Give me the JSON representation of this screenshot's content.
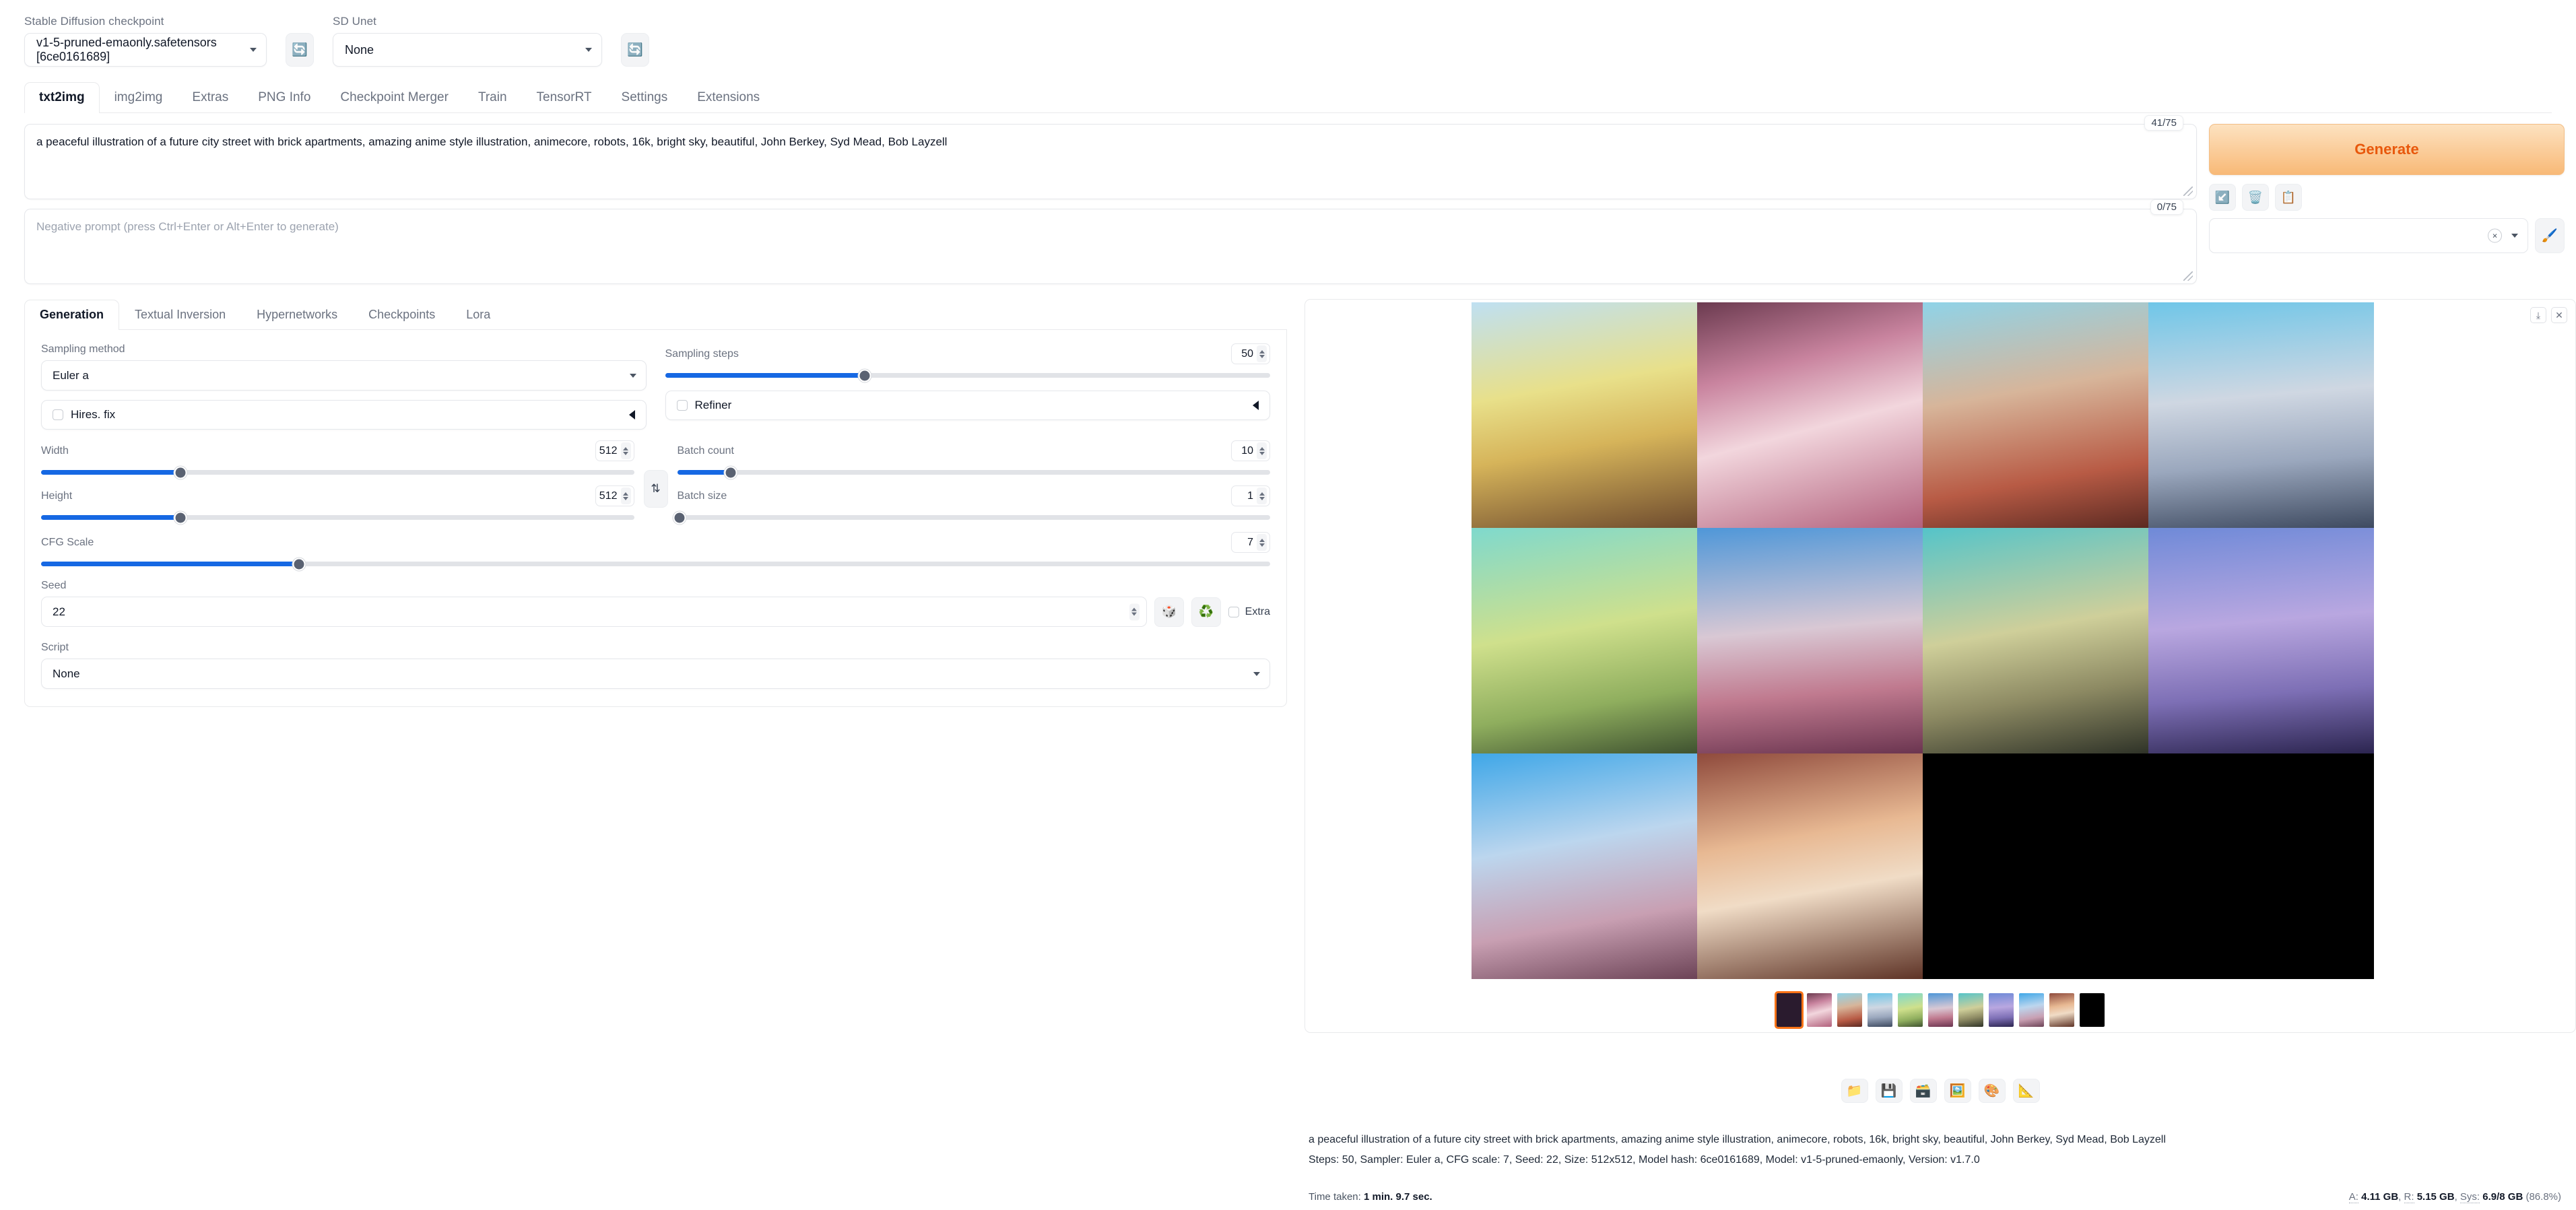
{
  "topbar": {
    "checkpoint_label": "Stable Diffusion checkpoint",
    "checkpoint_value": "v1-5-pruned-emaonly.safetensors [6ce0161689]",
    "unet_label": "SD Unet",
    "unet_value": "None",
    "refresh_icon": "refresh-icon"
  },
  "main_tabs": [
    {
      "label": "txt2img",
      "active": true
    },
    {
      "label": "img2img",
      "active": false
    },
    {
      "label": "Extras",
      "active": false
    },
    {
      "label": "PNG Info",
      "active": false
    },
    {
      "label": "Checkpoint Merger",
      "active": false
    },
    {
      "label": "Train",
      "active": false
    },
    {
      "label": "TensorRT",
      "active": false
    },
    {
      "label": "Settings",
      "active": false
    },
    {
      "label": "Extensions",
      "active": false
    }
  ],
  "prompt": {
    "positive_value": "a peaceful illustration of a future city street with brick apartments, amazing anime style illustration, animecore, robots, 16k, bright sky, beautiful, John Berkey, Syd Mead, Bob Layzell",
    "positive_tokens": "41/75",
    "negative_placeholder": "Negative prompt (press Ctrl+Enter or Alt+Enter to generate)",
    "negative_value": "",
    "negative_tokens": "0/75"
  },
  "generate": {
    "button_label": "Generate",
    "icons": [
      "arrow-into-box-icon",
      "trash-icon",
      "clipboard-icon"
    ],
    "styles_value": "",
    "styles_clear_glyph": "×",
    "brush_icon": "paintbrush-icon"
  },
  "sub_tabs": [
    {
      "label": "Generation",
      "active": true
    },
    {
      "label": "Textual Inversion",
      "active": false
    },
    {
      "label": "Hypernetworks",
      "active": false
    },
    {
      "label": "Checkpoints",
      "active": false
    },
    {
      "label": "Lora",
      "active": false
    }
  ],
  "settings": {
    "sampling_method": {
      "label": "Sampling method",
      "value": "Euler a"
    },
    "sampling_steps": {
      "label": "Sampling steps",
      "value": "50",
      "pct": 33
    },
    "hires_fix": {
      "label": "Hires. fix",
      "checked": false
    },
    "refiner": {
      "label": "Refiner",
      "checked": false
    },
    "width": {
      "label": "Width",
      "value": "512",
      "pct": 25
    },
    "height": {
      "label": "Height",
      "value": "512",
      "pct": 25
    },
    "batch_count": {
      "label": "Batch count",
      "value": "10",
      "pct": 11
    },
    "batch_size": {
      "label": "Batch size",
      "value": "1",
      "pct": 0
    },
    "cfg_scale": {
      "label": "CFG Scale",
      "value": "7",
      "pct": 21
    },
    "seed": {
      "label": "Seed",
      "value": "22"
    },
    "seed_buttons": [
      "dice-icon",
      "recycle-icon"
    ],
    "extra": {
      "label": "Extra",
      "checked": false
    },
    "script": {
      "label": "Script",
      "value": "None"
    },
    "swap_icon": "swap-dimensions-icon"
  },
  "gallery": {
    "tools": [
      "download-icon",
      "close-icon"
    ],
    "selected_thumb_index": 0,
    "under_tools": [
      "folder-icon",
      "save-icon",
      "save-zip-icon",
      "send-to-img2img-icon",
      "send-to-inpaint-icon",
      "send-to-extras-icon"
    ],
    "images": [
      {
        "name": "gen-image-1",
        "g": "linear-gradient(170deg,#bfe0f2 0%,#e8e08a 38%,#d6b45a 62%,#6e4b2e 100%)"
      },
      {
        "name": "gen-image-2",
        "g": "linear-gradient(165deg,#6b3a4f 0%,#c9849f 30%,#f2d6dd 55%,#b2607c 100%)"
      },
      {
        "name": "gen-image-3",
        "g": "linear-gradient(170deg,#8fd3e8 0%,#d7b59a 40%,#b85b45 75%,#5c2a22 100%)"
      },
      {
        "name": "gen-image-4",
        "g": "linear-gradient(175deg,#6fc6e8 0%,#cfd7e2 42%,#9aa7bd 70%,#3e4a60 100%)"
      },
      {
        "name": "gen-image-5",
        "g": "linear-gradient(170deg,#7fd9cd 0%,#cfe08c 45%,#8fae5e 75%,#3f5230 100%)"
      },
      {
        "name": "gen-image-6",
        "g": "linear-gradient(175deg,#4f97d8 0%,#d9c8d4 45%,#c07a8f 72%,#6b3550 100%)"
      },
      {
        "name": "gen-image-7",
        "g": "linear-gradient(170deg,#55c4c9 0%,#cfcf9a 45%,#8d8a63 72%,#2f3328 100%)"
      },
      {
        "name": "gen-image-8",
        "g": "linear-gradient(175deg,#6f8ad8 0%,#b9a7e0 42%,#7d6fb5 72%,#2c2550 100%)"
      },
      {
        "name": "gen-image-9",
        "g": "linear-gradient(170deg,#3fa7e8 0%,#bcd6ee 40%,#c89fb2 72%,#6c4356 100%)"
      },
      {
        "name": "gen-image-10",
        "g": "linear-gradient(170deg,#8f4a3c 0%,#e8b993 38%,#f0dcc6 60%,#5e3326 100%)"
      },
      {
        "name": "gen-image-empty-1",
        "g": "#000000"
      },
      {
        "name": "gen-image-empty-2",
        "g": "#000000"
      }
    ]
  },
  "info": {
    "prompt_line": "a peaceful illustration of a future city street with brick apartments, amazing anime style illustration, animecore, robots, 16k, bright sky, beautiful, John Berkey, Syd Mead, Bob Layzell",
    "params_line": "Steps: 50, Sampler: Euler a, CFG scale: 7, Seed: 22, Size: 512x512, Model hash: 6ce0161689, Model: v1-5-pruned-emaonly, Version: v1.7.0",
    "time_taken_label": "Time taken:",
    "time_taken_value": "1 min. 9.7 sec.",
    "mem_a_label": "A:",
    "mem_a_value": "4.11 GB",
    "mem_r_label": "R:",
    "mem_r_value": "5.15 GB",
    "mem_sys_label": "Sys:",
    "mem_sys_value": "6.9/8 GB",
    "mem_sys_pct": "(86.8%)"
  },
  "colors": {
    "accent_blue": "#1668e3",
    "generate_orange": "#e8580c",
    "selected_thumb": "#f97316"
  }
}
